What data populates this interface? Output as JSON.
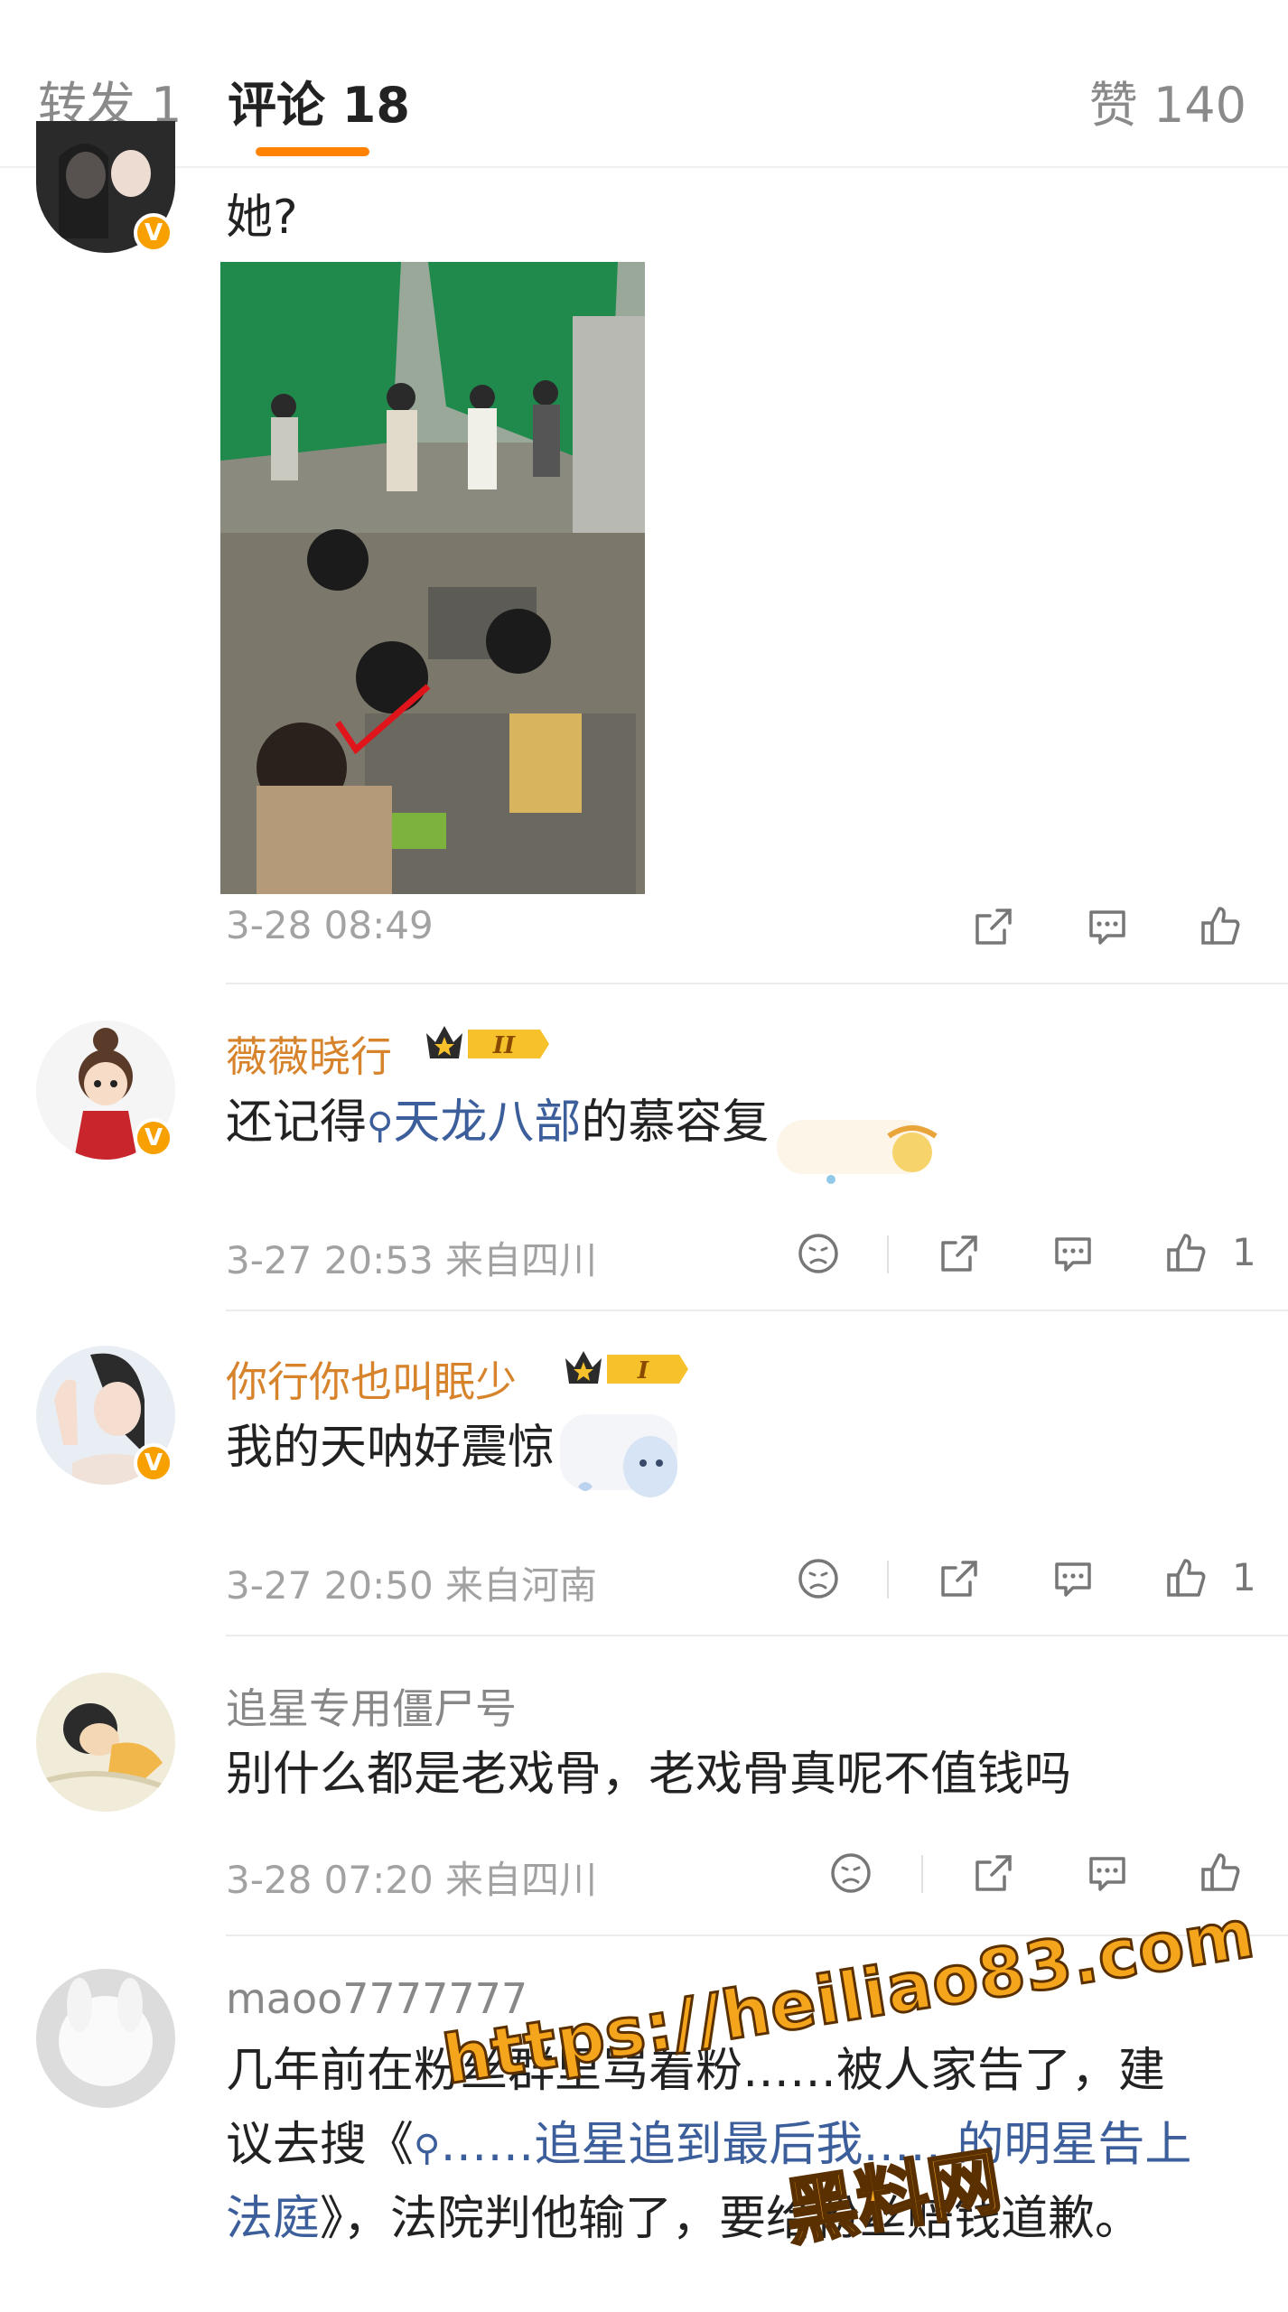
{
  "tabs": {
    "forward": "转发 1",
    "comment": "评论 18",
    "like": "赞 140"
  },
  "colors": {
    "accent": "#ff8200",
    "gold_name": "#d7832c",
    "topic_link": "#3c5f9c"
  },
  "comments": [
    {
      "text": "她?",
      "time": "3-28 08:49"
    },
    {
      "user": "薇薇晓行",
      "level": "II",
      "text_before": "还记得",
      "topic": "天龙八部",
      "text_after": "的慕容复",
      "time": "3-27 20:53 来自四川",
      "likes": "1"
    },
    {
      "user": "你行你也叫眠少",
      "level": "I",
      "text": "我的天呐好震惊",
      "time": "3-27 20:50 来自河南",
      "likes": "1"
    },
    {
      "user": "追星专用僵尸号",
      "text": "别什么都是老戏骨，老戏骨真呢不值钱吗",
      "time": "3-28 07:20 来自四川"
    },
    {
      "user": "maoo7777777",
      "line1": "几年前在粉丝群里骂着粉……被人家告了，建",
      "line2_before": "议去搜《",
      "line2_topic": "……追星追到最后我……的明星告上",
      "line3_topic": "法庭",
      "line3_after": "》，法院判他输了，要给粉丝赔钱道歉。"
    }
  ],
  "watermark": {
    "url": "https://heiliao83.com",
    "name": "黑料网"
  }
}
